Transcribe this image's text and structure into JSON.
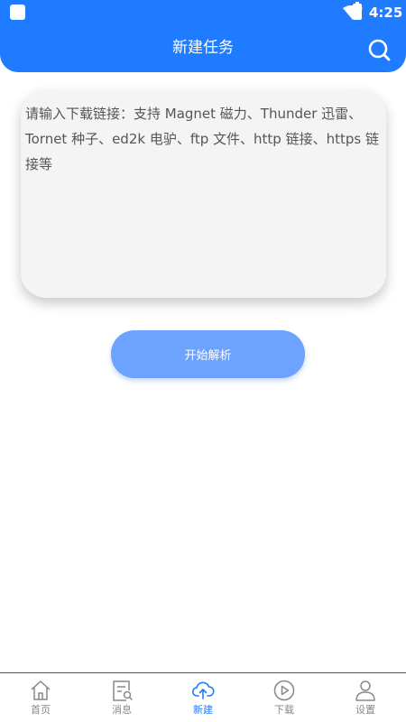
{
  "status_bar": {
    "time": "4:25"
  },
  "header": {
    "title": "新建任务",
    "search_icon": "search-icon"
  },
  "input": {
    "placeholder": "请输入下载链接：支持 Magnet 磁力、Thunder 迅雷、Tornet 种子、ed2k 电驴、ftp 文件、http 链接、https 链接等",
    "value": ""
  },
  "parse_button": {
    "label": "开始解析"
  },
  "bottom_nav": {
    "items": [
      {
        "label": "首页",
        "icon": "home-icon",
        "active": false
      },
      {
        "label": "消息",
        "icon": "message-icon",
        "active": false
      },
      {
        "label": "新建",
        "icon": "cloud-upload-icon",
        "active": true
      },
      {
        "label": "下载",
        "icon": "play-circle-icon",
        "active": false
      },
      {
        "label": "设置",
        "icon": "user-icon",
        "active": false
      }
    ]
  },
  "colors": {
    "primary": "#1f7bff",
    "button": "#6da2ff",
    "card": "#f4f4f4",
    "inactive": "#888888"
  }
}
